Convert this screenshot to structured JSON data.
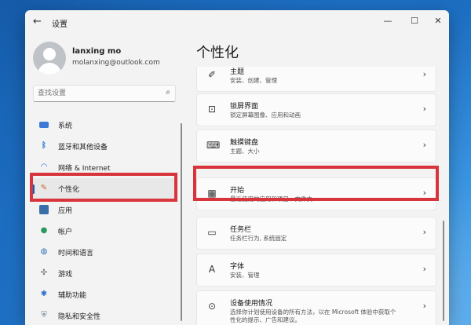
{
  "window": {
    "title": "设置",
    "back_icon": "back-arrow-icon"
  },
  "profile": {
    "name": "lanxing mo",
    "email": "molanxing@outlook.com"
  },
  "search": {
    "placeholder": "查找设置"
  },
  "nav": {
    "items": [
      {
        "label": "系统",
        "icon": "system-icon"
      },
      {
        "label": "蓝牙和其他设备",
        "icon": "bluetooth-icon"
      },
      {
        "label": "网络 & Internet",
        "icon": "wifi-icon"
      },
      {
        "label": "个性化",
        "icon": "pen-icon",
        "active": true
      },
      {
        "label": "应用",
        "icon": "apps-icon"
      },
      {
        "label": "帐户",
        "icon": "account-icon"
      },
      {
        "label": "时间和语言",
        "icon": "globe-icon"
      },
      {
        "label": "游戏",
        "icon": "gamepad-icon"
      },
      {
        "label": "辅助功能",
        "icon": "accessibility-icon"
      },
      {
        "label": "隐私和安全性",
        "icon": "shield-icon"
      }
    ]
  },
  "page": {
    "title": "个性化"
  },
  "cards": [
    {
      "title": "主题",
      "subtitle": "安装、创建、管理",
      "icon": "brush-icon"
    },
    {
      "title": "锁屏界面",
      "subtitle": "锁定屏幕图像、应用和动画",
      "icon": "lock-screen-icon"
    },
    {
      "title": "触摸键盘",
      "subtitle": "主题、大小",
      "icon": "keyboard-icon"
    },
    {
      "title": "开始",
      "subtitle": "最近使用的应用和项目、文件夹",
      "icon": "start-icon"
    },
    {
      "title": "任务栏",
      "subtitle": "任务栏行为, 系统固定",
      "icon": "taskbar-icon"
    },
    {
      "title": "字体",
      "subtitle": "安装、管理",
      "icon": "font-icon"
    },
    {
      "title": "设备使用情况",
      "subtitle_line1": "选择你计划使用设备的所有方法，以在 Microsoft 体验中获取个",
      "subtitle_line2": "性化的提示、广告和建议。",
      "icon": "device-usage-icon"
    }
  ],
  "colors": {
    "accent": "#0067c0",
    "highlight": "#d8343b"
  }
}
